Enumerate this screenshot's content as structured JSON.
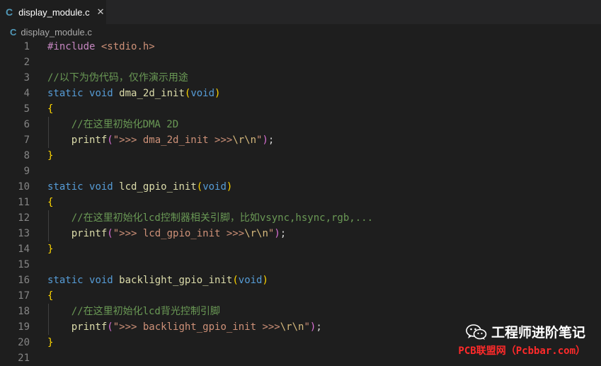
{
  "tab": {
    "icon": "C",
    "title": "display_module.c",
    "close": "✕"
  },
  "breadcrumb": {
    "icon": "C",
    "file": "display_module.c"
  },
  "editor": {
    "line_numbers": [
      "1",
      "2",
      "3",
      "4",
      "5",
      "6",
      "7",
      "8",
      "9",
      "10",
      "11",
      "12",
      "13",
      "14",
      "15",
      "16",
      "17",
      "18",
      "19",
      "20",
      "21"
    ],
    "code": {
      "l1_pp": "#include",
      "l1_hdr": " <stdio.h>",
      "l3_cm": "//以下为伪代码，仅作演示用途",
      "l4_kw1": "static",
      "l4_kw2": "void",
      "l4_fn": "dma_2d_init",
      "l4_po": "(",
      "l4_kw3": "void",
      "l4_pc": ")",
      "l5_b": "{",
      "l6_cm": "//在这里初始化DMA 2D",
      "l7_fn": "printf",
      "l7_po": "(",
      "l7_s1": "\">>> dma_2d_init >>>",
      "l7_e1": "\\r\\n",
      "l7_s2": "\"",
      "l7_pc": ")",
      "l7_semi": ";",
      "l8_b": "}",
      "l10_kw1": "static",
      "l10_kw2": "void",
      "l10_fn": "lcd_gpio_init",
      "l10_po": "(",
      "l10_kw3": "void",
      "l10_pc": ")",
      "l11_b": "{",
      "l12_cm": "//在这里初始化lcd控制器相关引脚，比如vsync,hsync,rgb,...",
      "l13_fn": "printf",
      "l13_po": "(",
      "l13_s1": "\">>> lcd_gpio_init >>>",
      "l13_e1": "\\r\\n",
      "l13_s2": "\"",
      "l13_pc": ")",
      "l13_semi": ";",
      "l14_b": "}",
      "l16_kw1": "static",
      "l16_kw2": "void",
      "l16_fn": "backlight_gpio_init",
      "l16_po": "(",
      "l16_kw3": "void",
      "l16_pc": ")",
      "l17_b": "{",
      "l18_cm": "//在这里初始化lcd背光控制引脚",
      "l19_fn": "printf",
      "l19_po": "(",
      "l19_s1": "\">>> backlight_gpio_init >>>",
      "l19_e1": "\\r\\n",
      "l19_s2": "\"",
      "l19_pc": ")",
      "l19_semi": ";",
      "l20_b": "}"
    }
  },
  "watermark": {
    "title": "工程师进阶笔记",
    "subtitle": "PCB联盟网（Pcbbar.com）"
  },
  "colors": {
    "background": "#1e1e1e",
    "keyword": "#569cd6",
    "function": "#dcdcaa",
    "string": "#ce9178",
    "comment": "#6a9955",
    "bracket_gold": "#ffd700",
    "bracket_purple": "#da70d6",
    "watermark_red": "#ff2a2a"
  }
}
